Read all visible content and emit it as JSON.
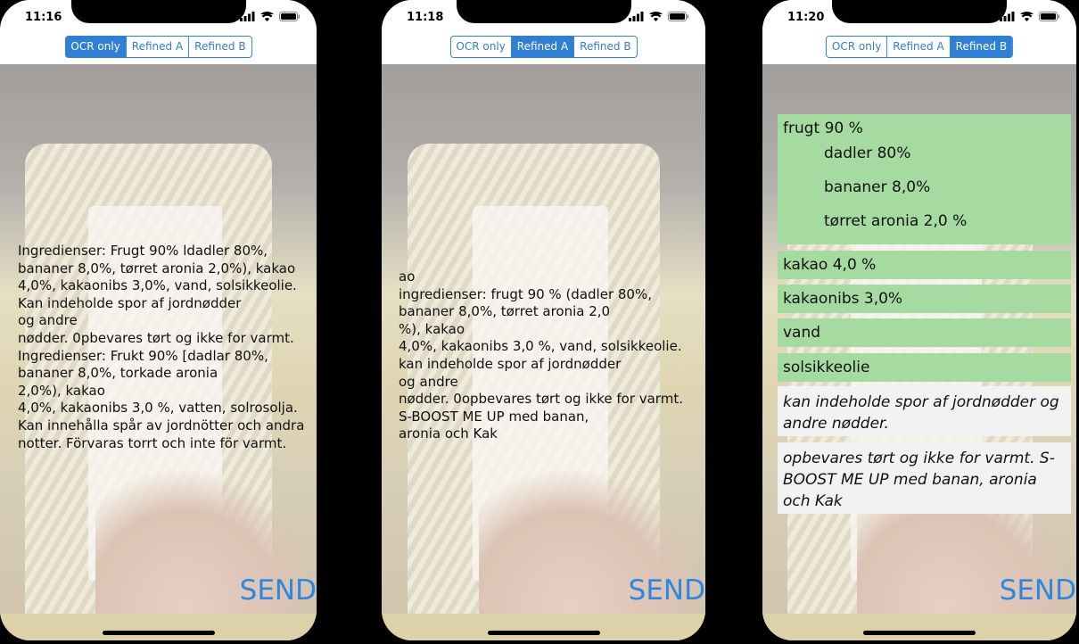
{
  "phones": [
    {
      "time": "11:16",
      "segments": [
        "OCR only",
        "Refined A",
        "Refined B"
      ],
      "active_segment": "OCR only",
      "ocr_text": "Ingredienser: Frugt 90% ldadler 80%,\nbananer 8,0%, tørret aronia 2,0%), kakao\n4,0%, kakaonibs 3,0%, vand, solsikkeolie.\nKan indeholde spor af jordnødder\nog andre\nnødder. 0pbevares tørt og ikke for varmt.\nIngredienser: Frukt 90% [dadlar 80%,\nbananer 8,0%, torkade aronia\n2,0%), kakao\n4,0%, kakaonibs 3,0 %, vatten, solrosolja.\nKan innehålla spår av jordnötter och andra\nnotter. Förvaras torrt och inte för varmt.",
      "send_label": "SEND"
    },
    {
      "time": "11:18",
      "segments": [
        "OCR only",
        "Refined A",
        "Refined B"
      ],
      "active_segment": "Refined A",
      "ocr_text": "ao\ningredienser: frugt 90 % (dadler 80%,\nbananer 8,0%, tørret aronia 2,0\n%), kakao\n4,0%, kakaonibs 3,0 %, vand, solsikkeolie.\nkan indeholde spor af jordnødder\nog andre\nnødder. 0opbevares tørt og ikke for varmt.\nS-BOOST ME UP med banan,\naronia och Kak",
      "send_label": "SEND"
    },
    {
      "time": "11:20",
      "segments": [
        "OCR only",
        "Refined A",
        "Refined B"
      ],
      "active_segment": "Refined B",
      "cards": {
        "frugt": "frugt 90 %",
        "dadler": "dadler 80%",
        "bananer": "bananer 8,0%",
        "aronia": "tørret aronia 2,0 %",
        "kakao": "kakao 4,0 %",
        "kakaonibs": "kakaonibs 3,0%",
        "vand": "vand",
        "solsikkeolie": "solsikkeolie",
        "allergen": "kan indeholde spor af jordnødder og andre nødder.",
        "storage": "opbevares tørt og ikke for varmt. S-BOOST ME UP med banan, aronia och Kak"
      },
      "send_label": "SEND"
    }
  ],
  "colors": {
    "accent": "#2f7fd4",
    "send": "#2f86e0",
    "green_card": "#a5dba0"
  }
}
